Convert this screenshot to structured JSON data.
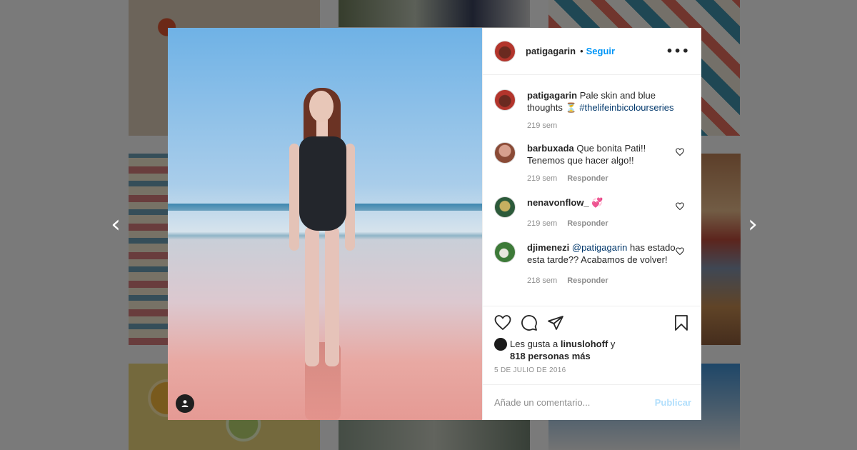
{
  "post": {
    "author": "patigagarin",
    "follow_label": "Seguir",
    "separator": "•",
    "more_label": "•••",
    "caption": {
      "username": "patigagarin",
      "text": "Pale skin and blue thoughts ⏳",
      "hashtag": "#thelifeinbicolourseries",
      "time": "219 sem"
    },
    "comments": [
      {
        "username": "barbuxada",
        "text": "Que bonita Pati!! Tenemos que hacer algo!!",
        "time": "219 sem",
        "reply_label": "Responder"
      },
      {
        "username": "nenavonflow_",
        "text": "💞",
        "time": "219 sem",
        "reply_label": "Responder"
      },
      {
        "username": "djimenezi",
        "mention": "@patigagarin",
        "text": "has estado esta tarde?? Acabamos de volver!",
        "time": "218 sem",
        "reply_label": "Responder"
      }
    ],
    "likes": {
      "prefix": "Les gusta a",
      "user": "linuslohoff",
      "suffix": "y",
      "others": "818 personas más"
    },
    "date": "5 DE JULIO DE 2016",
    "comment_input": {
      "placeholder": "Añade un comentario...",
      "value": ""
    },
    "publish_label": "Publicar"
  },
  "navigation": {
    "prev": "‹",
    "next": "›"
  },
  "colors": {
    "accent": "#0095f6",
    "publish_disabled": "#b2dffc",
    "link": "#00376b",
    "muted": "#8e8e8e"
  },
  "icons": [
    "user-tag-icon",
    "heart-icon",
    "comment-icon",
    "share-icon",
    "bookmark-icon",
    "more-icon",
    "chevron-left-icon",
    "chevron-right-icon"
  ]
}
